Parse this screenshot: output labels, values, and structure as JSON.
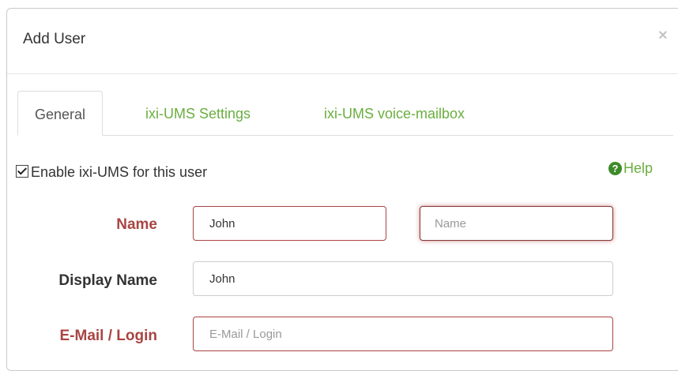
{
  "dialog": {
    "title": "Add User",
    "close_symbol": "×"
  },
  "tabs": [
    {
      "label": "General",
      "active": true
    },
    {
      "label": "ixi-UMS Settings",
      "active": false
    },
    {
      "label": "ixi-UMS voice-mailbox",
      "active": false
    }
  ],
  "enable": {
    "label": "Enable ixi-UMS for this user",
    "checked": true
  },
  "help": {
    "icon": "question-circle-icon",
    "label": "Help"
  },
  "form": {
    "name": {
      "label": "Name",
      "first_value": "John",
      "last_value": "",
      "last_placeholder": "Name"
    },
    "display_name": {
      "label": "Display Name",
      "value": "John"
    },
    "email": {
      "label": "E-Mail / Login",
      "value": "",
      "placeholder": "E-Mail / Login"
    }
  },
  "colors": {
    "accent_green": "#6aae3f",
    "error_red": "#a94442"
  }
}
